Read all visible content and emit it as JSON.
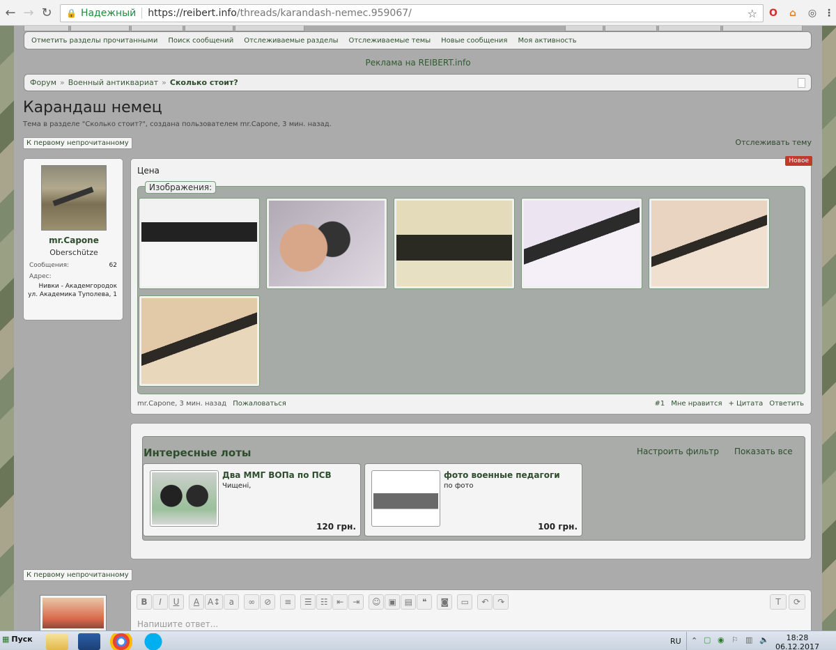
{
  "browser": {
    "security_label": "Надежный",
    "url_host": "https://reibert.info",
    "url_path": "/threads/karandash-nemec.959067/"
  },
  "subnav": {
    "items": [
      "Отметить разделы прочитанными",
      "Поиск сообщений",
      "Отслеживаемые разделы",
      "Отслеживаемые темы",
      "Новые сообщения",
      "Моя активность"
    ]
  },
  "ad_text": "Реклама на REIBERT.info",
  "breadcrumbs": {
    "items": [
      "Форум",
      "Военный антиквариат"
    ],
    "current": "Сколько стоит?",
    "separator": "»"
  },
  "thread": {
    "title": "Карандаш немец",
    "subtitle": "Тема в разделе \"Сколько стоит?\", создана пользователем mr.Capone, 3 мин. назад.",
    "first_unread_label": "К первому непрочитанному",
    "watch_label": "Отслеживать тему"
  },
  "author": {
    "name": "mr.Capone",
    "rank": "Oberschütze",
    "messages_label": "Сообщения:",
    "messages_value": "62",
    "address_label": "Адрес:",
    "address_value": "Нивки - Академгородок ул. Академика Туполева, 1"
  },
  "post": {
    "new_badge": "Новое",
    "text": "Цена",
    "attachments_label": "Изображения:",
    "footer_meta": "mr.Capone, 3 мин. назад",
    "report_label": "Пожаловаться",
    "number": "#1",
    "like_label": "Мне нравится",
    "quote_label": "+ Цитата",
    "reply_label": "Ответить"
  },
  "lots": {
    "title": "Интересные лоты",
    "filter_label": "Настроить фильтр",
    "show_all_label": "Показать все",
    "items": [
      {
        "name": "Два ММГ ВОПа по ПСВ",
        "desc": "Чищені,",
        "price": "120 грн."
      },
      {
        "name": "фото военные педагоги",
        "desc": "по фото",
        "price": "100 грн."
      }
    ]
  },
  "editor": {
    "placeholder": "Напишите ответ..."
  },
  "taskbar": {
    "start_label": "Пуск",
    "lang": "RU",
    "time": "18:28",
    "date": "06.12.2017"
  },
  "colors": {
    "accent_green": "#2d4d2d",
    "new_badge": "#c0392b",
    "secure_green": "#1e8e3e"
  }
}
